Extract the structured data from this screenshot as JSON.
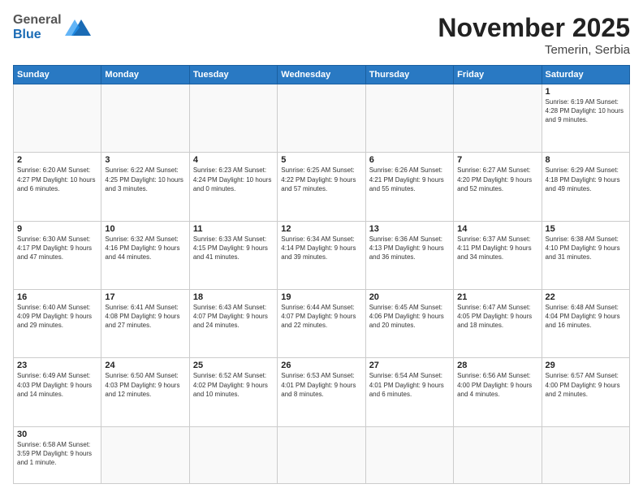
{
  "header": {
    "logo_general": "General",
    "logo_blue": "Blue",
    "month_title": "November 2025",
    "location": "Temerin, Serbia"
  },
  "days_of_week": [
    "Sunday",
    "Monday",
    "Tuesday",
    "Wednesday",
    "Thursday",
    "Friday",
    "Saturday"
  ],
  "weeks": [
    [
      {
        "day": "",
        "info": ""
      },
      {
        "day": "",
        "info": ""
      },
      {
        "day": "",
        "info": ""
      },
      {
        "day": "",
        "info": ""
      },
      {
        "day": "",
        "info": ""
      },
      {
        "day": "",
        "info": ""
      },
      {
        "day": "1",
        "info": "Sunrise: 6:19 AM\nSunset: 4:28 PM\nDaylight: 10 hours\nand 9 minutes."
      }
    ],
    [
      {
        "day": "2",
        "info": "Sunrise: 6:20 AM\nSunset: 4:27 PM\nDaylight: 10 hours\nand 6 minutes."
      },
      {
        "day": "3",
        "info": "Sunrise: 6:22 AM\nSunset: 4:25 PM\nDaylight: 10 hours\nand 3 minutes."
      },
      {
        "day": "4",
        "info": "Sunrise: 6:23 AM\nSunset: 4:24 PM\nDaylight: 10 hours\nand 0 minutes."
      },
      {
        "day": "5",
        "info": "Sunrise: 6:25 AM\nSunset: 4:22 PM\nDaylight: 9 hours\nand 57 minutes."
      },
      {
        "day": "6",
        "info": "Sunrise: 6:26 AM\nSunset: 4:21 PM\nDaylight: 9 hours\nand 55 minutes."
      },
      {
        "day": "7",
        "info": "Sunrise: 6:27 AM\nSunset: 4:20 PM\nDaylight: 9 hours\nand 52 minutes."
      },
      {
        "day": "8",
        "info": "Sunrise: 6:29 AM\nSunset: 4:18 PM\nDaylight: 9 hours\nand 49 minutes."
      }
    ],
    [
      {
        "day": "9",
        "info": "Sunrise: 6:30 AM\nSunset: 4:17 PM\nDaylight: 9 hours\nand 47 minutes."
      },
      {
        "day": "10",
        "info": "Sunrise: 6:32 AM\nSunset: 4:16 PM\nDaylight: 9 hours\nand 44 minutes."
      },
      {
        "day": "11",
        "info": "Sunrise: 6:33 AM\nSunset: 4:15 PM\nDaylight: 9 hours\nand 41 minutes."
      },
      {
        "day": "12",
        "info": "Sunrise: 6:34 AM\nSunset: 4:14 PM\nDaylight: 9 hours\nand 39 minutes."
      },
      {
        "day": "13",
        "info": "Sunrise: 6:36 AM\nSunset: 4:13 PM\nDaylight: 9 hours\nand 36 minutes."
      },
      {
        "day": "14",
        "info": "Sunrise: 6:37 AM\nSunset: 4:11 PM\nDaylight: 9 hours\nand 34 minutes."
      },
      {
        "day": "15",
        "info": "Sunrise: 6:38 AM\nSunset: 4:10 PM\nDaylight: 9 hours\nand 31 minutes."
      }
    ],
    [
      {
        "day": "16",
        "info": "Sunrise: 6:40 AM\nSunset: 4:09 PM\nDaylight: 9 hours\nand 29 minutes."
      },
      {
        "day": "17",
        "info": "Sunrise: 6:41 AM\nSunset: 4:08 PM\nDaylight: 9 hours\nand 27 minutes."
      },
      {
        "day": "18",
        "info": "Sunrise: 6:43 AM\nSunset: 4:07 PM\nDaylight: 9 hours\nand 24 minutes."
      },
      {
        "day": "19",
        "info": "Sunrise: 6:44 AM\nSunset: 4:07 PM\nDaylight: 9 hours\nand 22 minutes."
      },
      {
        "day": "20",
        "info": "Sunrise: 6:45 AM\nSunset: 4:06 PM\nDaylight: 9 hours\nand 20 minutes."
      },
      {
        "day": "21",
        "info": "Sunrise: 6:47 AM\nSunset: 4:05 PM\nDaylight: 9 hours\nand 18 minutes."
      },
      {
        "day": "22",
        "info": "Sunrise: 6:48 AM\nSunset: 4:04 PM\nDaylight: 9 hours\nand 16 minutes."
      }
    ],
    [
      {
        "day": "23",
        "info": "Sunrise: 6:49 AM\nSunset: 4:03 PM\nDaylight: 9 hours\nand 14 minutes."
      },
      {
        "day": "24",
        "info": "Sunrise: 6:50 AM\nSunset: 4:03 PM\nDaylight: 9 hours\nand 12 minutes."
      },
      {
        "day": "25",
        "info": "Sunrise: 6:52 AM\nSunset: 4:02 PM\nDaylight: 9 hours\nand 10 minutes."
      },
      {
        "day": "26",
        "info": "Sunrise: 6:53 AM\nSunset: 4:01 PM\nDaylight: 9 hours\nand 8 minutes."
      },
      {
        "day": "27",
        "info": "Sunrise: 6:54 AM\nSunset: 4:01 PM\nDaylight: 9 hours\nand 6 minutes."
      },
      {
        "day": "28",
        "info": "Sunrise: 6:56 AM\nSunset: 4:00 PM\nDaylight: 9 hours\nand 4 minutes."
      },
      {
        "day": "29",
        "info": "Sunrise: 6:57 AM\nSunset: 4:00 PM\nDaylight: 9 hours\nand 2 minutes."
      }
    ],
    [
      {
        "day": "30",
        "info": "Sunrise: 6:58 AM\nSunset: 3:59 PM\nDaylight: 9 hours\nand 1 minute."
      },
      {
        "day": "",
        "info": ""
      },
      {
        "day": "",
        "info": ""
      },
      {
        "day": "",
        "info": ""
      },
      {
        "day": "",
        "info": ""
      },
      {
        "day": "",
        "info": ""
      },
      {
        "day": "",
        "info": ""
      }
    ]
  ]
}
